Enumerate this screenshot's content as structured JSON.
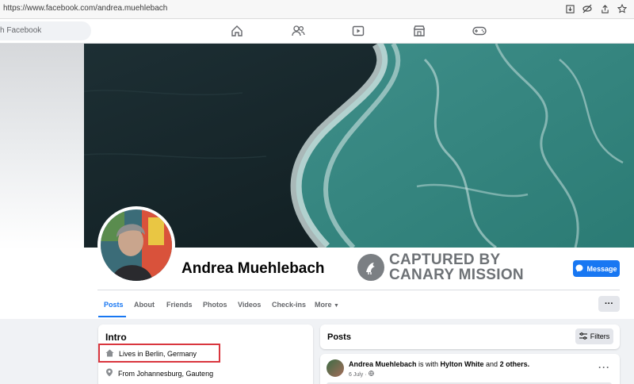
{
  "browser": {
    "url": "https://www.facebook.com/andrea.muehlebach"
  },
  "fb_nav": {
    "search_placeholder": "h Facebook",
    "icons": [
      "home-icon",
      "friends-icon",
      "watch-icon",
      "marketplace-icon",
      "gaming-icon"
    ]
  },
  "profile": {
    "name": "Andrea Muehlebach",
    "message_label": "Message"
  },
  "watermark": {
    "line1": "CAPTURED BY",
    "line2": "CANARY MISSION"
  },
  "tabs": [
    {
      "label": "Posts",
      "active": true
    },
    {
      "label": "About"
    },
    {
      "label": "Friends"
    },
    {
      "label": "Photos"
    },
    {
      "label": "Videos"
    },
    {
      "label": "Check-ins"
    },
    {
      "label": "More"
    }
  ],
  "intro": {
    "title": "Intro",
    "lives_prefix": "Lives in ",
    "lives_value": "Berlin, Germany",
    "from_prefix": "From ",
    "from_value": "Johannesburg, Gauteng"
  },
  "posts": {
    "title": "Posts",
    "filters_label": "Filters",
    "post": {
      "author": "Andrea Muehlebach",
      "with_text": " is with ",
      "tagged": "Hylton White",
      "and_text": " and ",
      "others": "2 others.",
      "date": "6 July · "
    }
  },
  "colors": {
    "accent": "#1877f2",
    "highlight": "#d9363e"
  }
}
